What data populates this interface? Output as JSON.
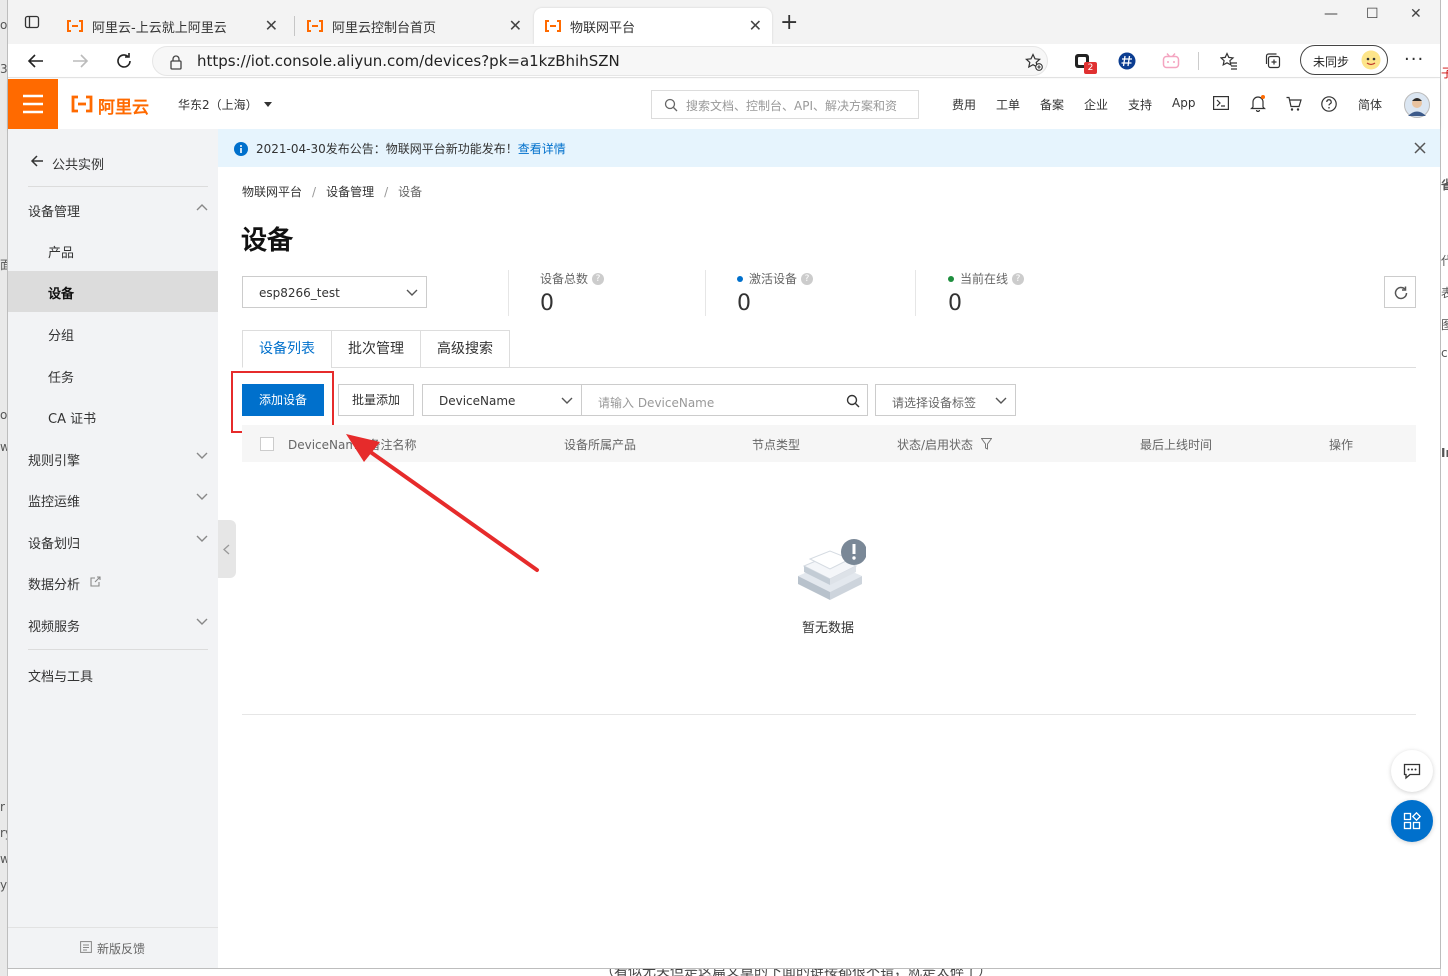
{
  "background": {
    "left_fragments": [
      "os",
      "3",
      "面",
      "oa",
      "w",
      "r",
      "ry",
      "w",
      "y"
    ],
    "right_fragments": [
      "子",
      "省",
      "代",
      "表",
      "图",
      "cl",
      "In"
    ],
    "bottom_text": "（看似无关但是这篇文章的下面的链接都很不错，就是太碎了）"
  },
  "browser": {
    "tabs": [
      {
        "title": "阿里云-上云就上阿里云",
        "active": false
      },
      {
        "title": "阿里云控制台首页",
        "active": false
      },
      {
        "title": "物联网平台",
        "active": true
      }
    ],
    "url": "https://iot.console.aliyun.com/devices?pk=a1kzBhihSZN",
    "extension_badge": "2",
    "sync_label": "未同步"
  },
  "topbar": {
    "brand": "阿里云",
    "region": "华东2（上海）",
    "search_placeholder": "搜索文档、控制台、API、解决方案和资",
    "links": [
      "费用",
      "工单",
      "备案",
      "企业",
      "支持",
      "App"
    ],
    "language": "简体"
  },
  "sidebar": {
    "back_label": "公共实例",
    "group_label": "设备管理",
    "items": [
      "产品",
      "设备",
      "分组",
      "任务",
      "CA 证书"
    ],
    "selected": "设备",
    "sections": [
      "规则引擎",
      "监控运维",
      "设备划归",
      "数据分析",
      "视频服务"
    ],
    "docs": "文档与工具",
    "feedback": "新版反馈"
  },
  "notice": {
    "text": "2021-04-30发布公告：物联网平台新功能发布！",
    "link": "查看详情"
  },
  "breadcrumb": [
    "物联网平台",
    "设备管理",
    "设备"
  ],
  "page_title": "设备",
  "product_select": "esp8266_test",
  "stats": [
    {
      "label": "设备总数",
      "value": "0",
      "dot": ""
    },
    {
      "label": "激活设备",
      "value": "0",
      "dot": "#0070cc"
    },
    {
      "label": "当前在线",
      "value": "0",
      "dot": "#1e8e3e"
    }
  ],
  "tabs": [
    "设备列表",
    "批次管理",
    "高级搜索"
  ],
  "toolbar": {
    "add_label": "添加设备",
    "batch_label": "批量添加",
    "field_select": "DeviceName",
    "query_placeholder": "请输入 DeviceName",
    "tag_placeholder": "请选择设备标签"
  },
  "table": {
    "columns": [
      "DeviceName/备注名称",
      "设备所属产品",
      "节点类型",
      "状态/启用状态",
      "最后上线时间",
      "操作"
    ],
    "empty_text": "暂无数据"
  },
  "colors": {
    "accent": "#ff6a00",
    "primary": "#0070cc",
    "highlight": "#e62b2b"
  }
}
